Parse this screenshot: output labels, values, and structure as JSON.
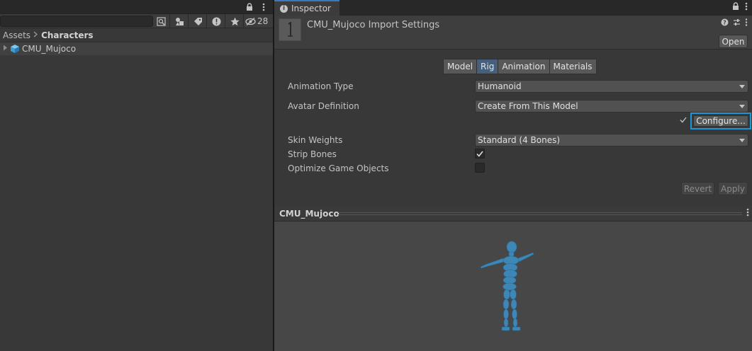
{
  "project": {
    "hidden_count": "28",
    "breadcrumb": {
      "root": "Assets",
      "current": "Characters"
    },
    "tree": [
      {
        "label": "CMU_Mujoco"
      }
    ]
  },
  "inspector": {
    "tab_label": "Inspector",
    "title": "CMU_Mujoco Import Settings",
    "open_label": "Open",
    "tabs": [
      "Model",
      "Rig",
      "Animation",
      "Materials"
    ],
    "active_tab": "Rig",
    "rig": {
      "animation_type": {
        "label": "Animation Type",
        "value": "Humanoid"
      },
      "avatar_definition": {
        "label": "Avatar Definition",
        "value": "Create From This Model"
      },
      "configure_label": "Configure...",
      "skin_weights": {
        "label": "Skin Weights",
        "value": "Standard (4 Bones)"
      },
      "strip_bones": {
        "label": "Strip Bones",
        "checked": true
      },
      "optimize_game_objects": {
        "label": "Optimize Game Objects",
        "checked": false
      }
    },
    "revert_label": "Revert",
    "apply_label": "Apply",
    "preview": {
      "title": "CMU_Mujoco"
    }
  },
  "colors": {
    "accent_blue": "#1a98d5",
    "active_tab": "#46607c",
    "figure": "#3d86b5"
  },
  "icons": [
    "lock-icon",
    "kebab-menu-icon",
    "search-by-type-icon",
    "label-icon",
    "warning-icon",
    "star-icon",
    "hidden-eye-icon",
    "prefab-cube-icon",
    "info-icon",
    "settings-sliders-icon",
    "checkmark-icon"
  ]
}
